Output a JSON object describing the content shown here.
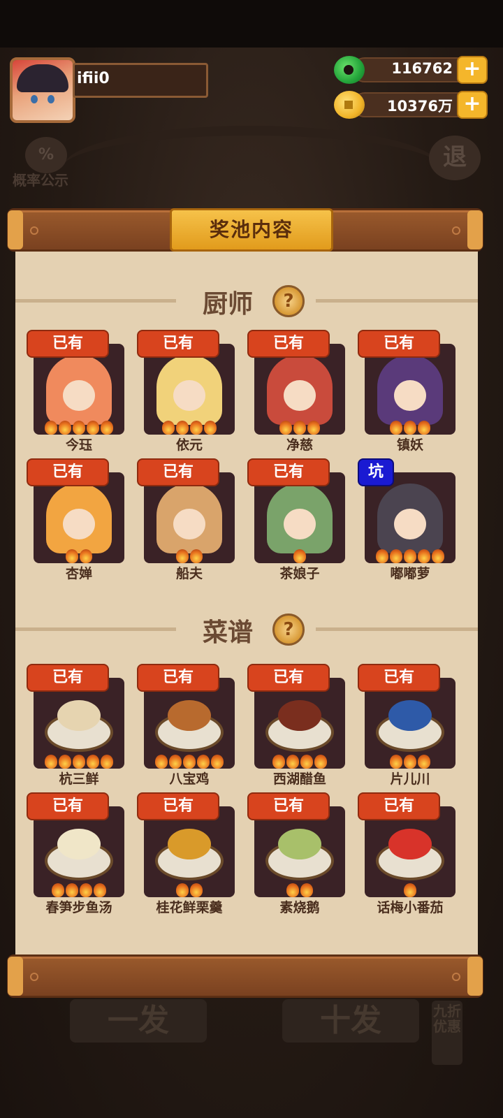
{
  "player": {
    "name": "ifii0"
  },
  "currencies": [
    {
      "icon": "jade-icon",
      "value": "116762"
    },
    {
      "icon": "coin-icon",
      "value": "10376万"
    }
  ],
  "plus_label": "+",
  "background": {
    "prob_icon_label": "%",
    "prob_label": "概率公示",
    "exit_label": "退",
    "single_draw": "一发",
    "ten_draw": "十发",
    "discount": "九折优惠"
  },
  "panel": {
    "title": "奖池内容",
    "help_label": "?",
    "sections": [
      {
        "title": "厨师",
        "items": [
          {
            "name": "今珏",
            "tag": "已有",
            "stars": 5,
            "color": "#f08a5d"
          },
          {
            "name": "依元",
            "tag": "已有",
            "stars": 4,
            "color": "#f1d27a"
          },
          {
            "name": "净慈",
            "tag": "已有",
            "stars": 3,
            "color": "#c94b3c"
          },
          {
            "name": "镇妖",
            "tag": "已有",
            "stars": 3,
            "color": "#5a3a7a"
          },
          {
            "name": "杏婵",
            "tag": "已有",
            "stars": 2,
            "color": "#f2a541"
          },
          {
            "name": "船夫",
            "tag": "已有",
            "stars": 2,
            "color": "#d9a46b"
          },
          {
            "name": "茶娘子",
            "tag": "已有",
            "stars": 1,
            "color": "#7aa36a"
          },
          {
            "name": "嘟嘟萝",
            "tag": "坑",
            "stars": 5,
            "color": "#4b4450"
          }
        ]
      },
      {
        "title": "菜谱",
        "items": [
          {
            "name": "杭三鲜",
            "tag": "已有",
            "stars": 5,
            "color": "#e6d4b0"
          },
          {
            "name": "八宝鸡",
            "tag": "已有",
            "stars": 5,
            "color": "#b86a2e"
          },
          {
            "name": "西湖醋鱼",
            "tag": "已有",
            "stars": 4,
            "color": "#7a2e1e"
          },
          {
            "name": "片儿川",
            "tag": "已有",
            "stars": 3,
            "color": "#2e5aa8"
          },
          {
            "name": "春笋步鱼汤",
            "tag": "已有",
            "stars": 4,
            "color": "#f0e6c8"
          },
          {
            "name": "桂花鲜栗羹",
            "tag": "已有",
            "stars": 2,
            "color": "#d99a2a"
          },
          {
            "name": "素烧鹅",
            "tag": "已有",
            "stars": 2,
            "color": "#a8c06a"
          },
          {
            "name": "话梅小番茄",
            "tag": "已有",
            "stars": 1,
            "color": "#d8332a"
          }
        ]
      }
    ]
  }
}
